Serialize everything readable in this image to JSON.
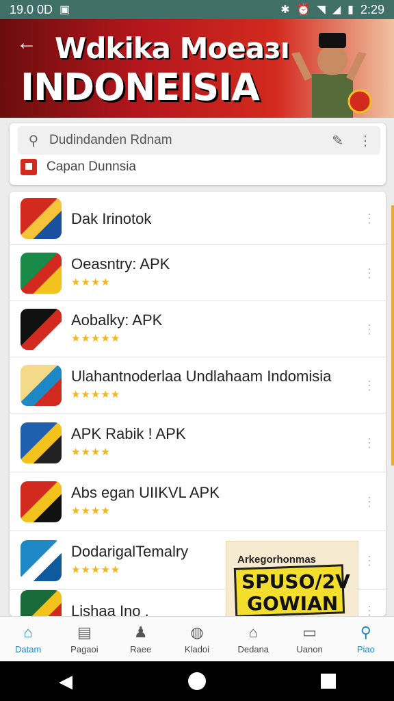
{
  "status_bar": {
    "time_left": "19.0 0D",
    "time_right": "2:29"
  },
  "banner": {
    "title_line1": "Wdkika Moeaзı",
    "title_line2": "INDONEISIA"
  },
  "search": {
    "value": "Dudindanden Rdnam",
    "suggestion": "Capan Dunnsia"
  },
  "apps": [
    {
      "name": "Dak Irinotok",
      "stars": "",
      "icon_colors": [
        "#d32a1f",
        "#f5c43a",
        "#1b4fa0"
      ]
    },
    {
      "name": "Oeasntry: APK",
      "stars": "★★★★",
      "icon_colors": [
        "#1a8a48",
        "#d32a1f",
        "#f3c21d"
      ]
    },
    {
      "name": "Aobalky: APK",
      "stars": "★★★★★",
      "icon_colors": [
        "#111111",
        "#d32a1f",
        "#ffffff"
      ]
    },
    {
      "name": "Ulahantnoderlaa Undlahaam Indomisia",
      "stars": "★★★★★",
      "icon_colors": [
        "#f4d98a",
        "#1e88c7",
        "#d32a1f"
      ]
    },
    {
      "name": "APK Rabik ! APK",
      "stars": "★★★★",
      "icon_colors": [
        "#1e5fb0",
        "#f3c21d",
        "#222222"
      ]
    },
    {
      "name": "Abs egan UIIKVL APK",
      "stars": "★★★★",
      "icon_colors": [
        "#d32a1f",
        "#f3c21d",
        "#111111"
      ]
    },
    {
      "name": "DodarigalTemalry",
      "stars": "★★★★★",
      "icon_colors": [
        "#1e88c7",
        "#ffffff",
        "#0f5a9e"
      ]
    },
    {
      "name": "Lishaa Ino .",
      "stars": "",
      "icon_colors": [
        "#1a6b3a",
        "#f3c21d",
        "#d32a1f"
      ]
    }
  ],
  "ad": {
    "top": "Arkegorhonmas",
    "line1": "SPUSO/2V",
    "line2": "GOWIAN"
  },
  "bottom_nav": [
    {
      "label": "Datam",
      "icon": "home-icon",
      "active": true
    },
    {
      "label": "Pagaoi",
      "icon": "store-icon",
      "active": false
    },
    {
      "label": "Raee",
      "icon": "person-icon",
      "active": false
    },
    {
      "label": "Kladoi",
      "icon": "globe-icon",
      "active": false
    },
    {
      "label": "Dedana",
      "icon": "building-icon",
      "active": false
    },
    {
      "label": "Uanon",
      "icon": "chat-icon",
      "active": false
    },
    {
      "label": "Piao",
      "icon": "profile-icon",
      "active": true
    }
  ],
  "colors": {
    "accent": "#1e88c7",
    "banner_red": "#d32a1f",
    "star": "#f3b51c"
  }
}
